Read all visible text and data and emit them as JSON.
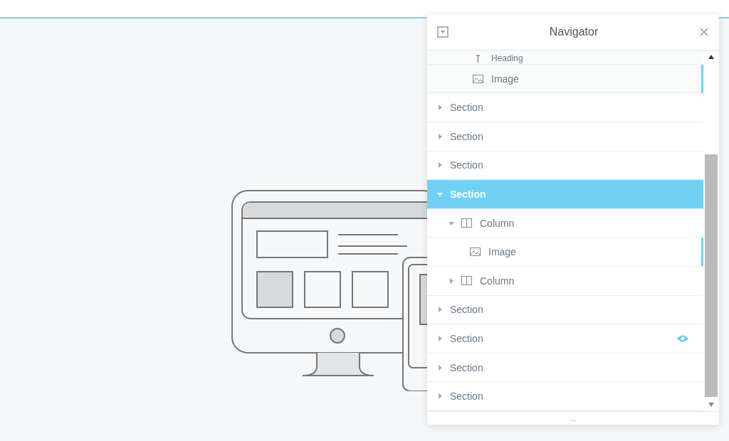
{
  "navigator": {
    "title": "Navigator",
    "scrolled_items": [
      {
        "label": "Heading",
        "kind": "heading",
        "highlighted": false,
        "partial": true
      },
      {
        "label": "Image",
        "kind": "image",
        "highlighted": true,
        "partial": false
      }
    ],
    "items": [
      {
        "label": "Section",
        "kind": "section",
        "expanded": false,
        "selected": false,
        "highlighted": false,
        "show_eye": false
      },
      {
        "label": "Section",
        "kind": "section",
        "expanded": false,
        "selected": false,
        "highlighted": false,
        "show_eye": false
      },
      {
        "label": "Section",
        "kind": "section",
        "expanded": false,
        "selected": false,
        "highlighted": false,
        "show_eye": false
      },
      {
        "label": "Section",
        "kind": "section",
        "expanded": true,
        "selected": true,
        "highlighted": false,
        "show_eye": false,
        "children": [
          {
            "label": "Column",
            "kind": "column",
            "expanded": true,
            "selected": false,
            "highlighted": false,
            "show_eye": false,
            "children": [
              {
                "label": "Image",
                "kind": "image",
                "selected": false,
                "highlighted": true,
                "show_eye": false
              }
            ]
          },
          {
            "label": "Column",
            "kind": "column",
            "expanded": false,
            "selected": false,
            "highlighted": false,
            "show_eye": false
          }
        ]
      },
      {
        "label": "Section",
        "kind": "section",
        "expanded": false,
        "selected": false,
        "highlighted": false,
        "show_eye": false
      },
      {
        "label": "Section",
        "kind": "section",
        "expanded": false,
        "selected": false,
        "highlighted": false,
        "show_eye": true
      },
      {
        "label": "Section",
        "kind": "section",
        "expanded": false,
        "selected": false,
        "highlighted": false,
        "show_eye": false
      },
      {
        "label": "Section",
        "kind": "section",
        "expanded": false,
        "selected": false,
        "highlighted": false,
        "show_eye": false
      }
    ],
    "footer": "..."
  }
}
